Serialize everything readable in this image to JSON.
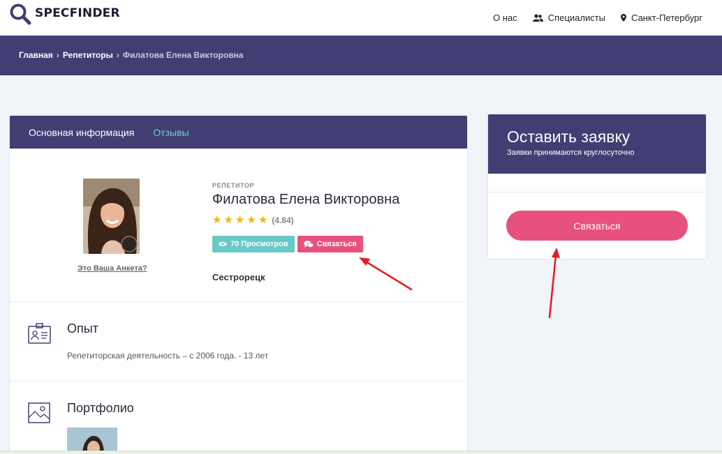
{
  "brand": {
    "name": "SPECFINDER",
    "accent": "#413e74",
    "pink": "#e8517e",
    "teal": "#6ac9c6"
  },
  "nav": {
    "about": "О нас",
    "specialists": "Специалисты",
    "city": "Санкт-Петербург"
  },
  "breadcrumb": {
    "home": "Главная",
    "section": "Репетиторы",
    "current": "Филатова Елена Викторовна",
    "separator": "›"
  },
  "profile": {
    "tabs": {
      "main": "Основная информация",
      "reviews": "Отзывы"
    },
    "role": "РЕПЕТИТОР",
    "name": "Филатова Елена Викторовна",
    "stars": 5,
    "rating": "(4.84)",
    "views_badge": "70 Просмотров",
    "contact_badge": "Связаться",
    "claim_link": "Это Ваша Анкета?",
    "location": "Сестрорецк"
  },
  "experience": {
    "title": "Опыт",
    "text": "Репетиторская деятельность – с 2006 года. - 13 лет"
  },
  "portfolio": {
    "title": "Портфолио"
  },
  "request": {
    "title": "Оставить заявку",
    "subtitle": "Заявки принимаются круглосуточно",
    "button": "Связаться"
  },
  "icons": [
    "search-logo-icon",
    "users-icon",
    "map-pin-icon",
    "eye-icon",
    "chat-icon",
    "id-card-icon",
    "image-icon",
    "star-icon"
  ]
}
